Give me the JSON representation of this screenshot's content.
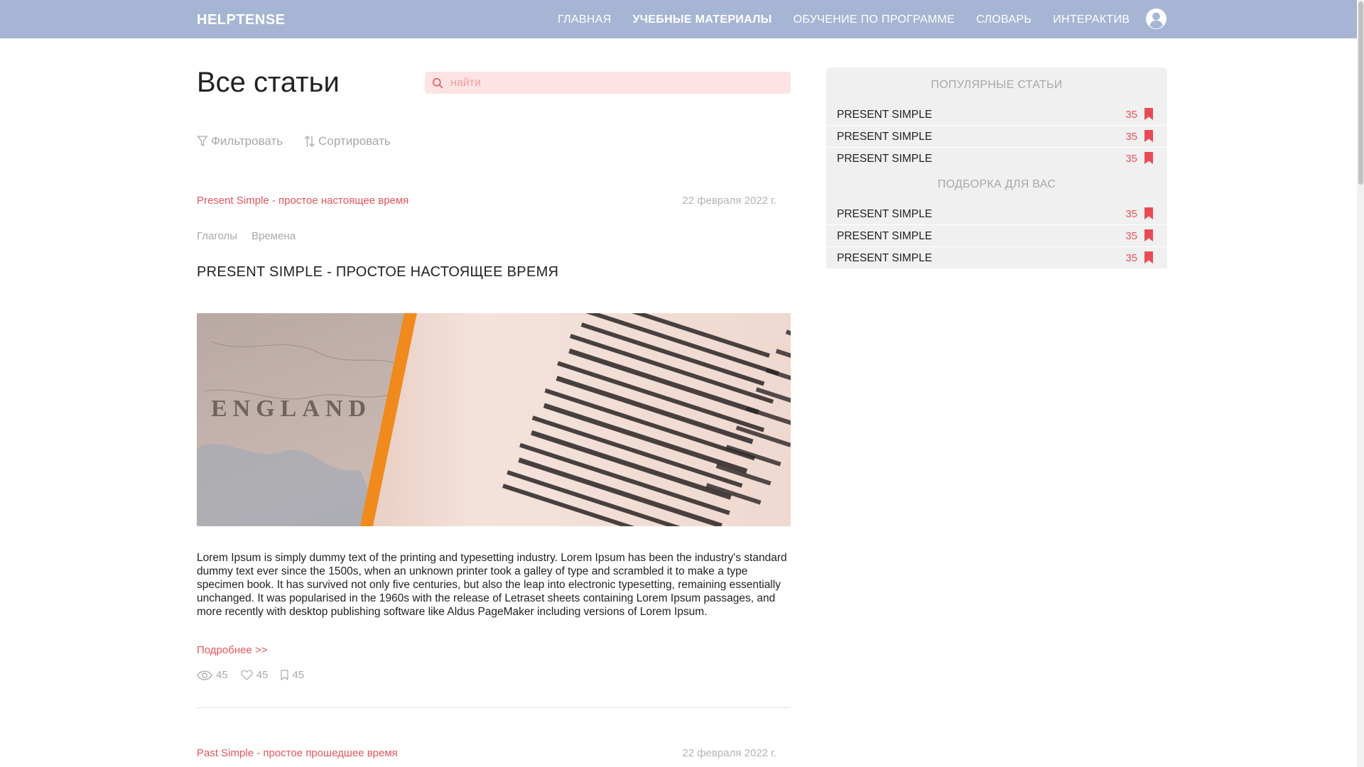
{
  "header": {
    "brand": "HELPTENSE",
    "nav": [
      {
        "label": "ГЛАВНАЯ"
      },
      {
        "label": "УЧЕБНЫЕ МАТЕРИАЛЫ"
      },
      {
        "label": "ОБУЧЕНИЕ ПО ПРОГРАММЕ"
      },
      {
        "label": "СЛОВАРЬ"
      },
      {
        "label": "ИНТЕРАКТИВ"
      }
    ],
    "active_nav": "УЧЕБНЫЕ МАТЕРИАЛЫ",
    "avatar_icon": "user-circle-icon"
  },
  "main": {
    "title": "Все статьи",
    "search": {
      "placeholder": "найти",
      "value": ""
    },
    "filter_label": "Фильтровать",
    "sort_label": "Сортировать",
    "articles": [
      {
        "link": "Present Simple - простое настоящее время",
        "date": "22 февраля 2022 г.",
        "tags": [
          "Глаголы",
          "Времена"
        ],
        "title": "PRESENT SIMPLE - ПРОСТОЕ НАСТОЯЩЕЕ ВРЕМЯ",
        "image_caption": "ENGLAND",
        "text": "Lorem Ipsum is simply dummy text of the printing and typesetting industry. Lorem Ipsum has been the industry's standard dummy text ever since the 1500s, when an unknown printer took a galley of type and scrambled it to make a type specimen book. It has survived not only five centuries, but also the leap into electronic typesetting, remaining essentially unchanged. It was popularised in the 1960s with the release of Letraset sheets containing Lorem Ipsum passages, and more recently with desktop publishing software like Aldus PageMaker including versions of Lorem Ipsum.",
        "more": "Подробнее >>",
        "views": "45",
        "likes": "45",
        "bookmarks": "45"
      },
      {
        "link": "Past Simple - простое прошедшее время",
        "date": "22 февраля 2022 г."
      }
    ]
  },
  "sidebar": {
    "popular_title": "ПОПУЛЯРНЫЕ СТАТЬИ",
    "popular": [
      {
        "name": "PRESENT SIMPLE",
        "count": "35"
      },
      {
        "name": "PRESENT SIMPLE",
        "count": "35"
      },
      {
        "name": "PRESENT SIMPLE",
        "count": "35"
      }
    ],
    "picks_title": "ПОДБОРКА ДЛЯ ВАС",
    "picks": [
      {
        "name": "PRESENT SIMPLE",
        "count": "35"
      },
      {
        "name": "PRESENT SIMPLE",
        "count": "35"
      },
      {
        "name": "PRESENT SIMPLE",
        "count": "35"
      }
    ]
  },
  "colors": {
    "header_bg": "#a6b5d3",
    "accent": "#e3555d",
    "search_bg": "#fde3e3",
    "muted": "#a8a8a8",
    "sidebar_bg": "#f0f0f0"
  }
}
